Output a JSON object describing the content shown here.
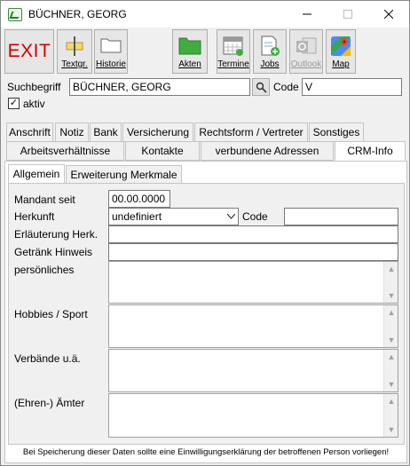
{
  "window": {
    "title": "BÜCHNER, GEORG"
  },
  "toolbar": {
    "exit_label": "EXIT",
    "buttons": [
      {
        "label": "Textgr."
      },
      {
        "label": "Historie"
      },
      {
        "label": "Akten"
      },
      {
        "label": "Termine"
      },
      {
        "label": "Jobs"
      },
      {
        "label": "Outlook"
      },
      {
        "label": "Map"
      }
    ]
  },
  "search": {
    "label": "Suchbegriff",
    "value": "BÜCHNER, GEORG",
    "code_label": "Code",
    "code_value": "V",
    "active_label": "aktiv",
    "active_checked": "✓"
  },
  "tabs_row1": [
    "Anschrift",
    "Notiz",
    "Bank",
    "Versicherung",
    "Rechtsform / Vertreter",
    "Sonstiges"
  ],
  "tabs_row2": [
    "Arbeitsverhältnisse",
    "Kontakte",
    "verbundene Adressen",
    "CRM-Info"
  ],
  "subtabs": [
    "Allgemein",
    "Erweiterung Merkmale"
  ],
  "form": {
    "mandant_label": "Mandant seit",
    "mandant_value": "00.00.0000",
    "herkunft_label": "Herkunft",
    "herkunft_value": "undefiniert",
    "code_label": "Code",
    "code_value": "",
    "erlaeuterung_label": "Erläuterung Herk.",
    "getraenk_label": "Getränk Hinweis",
    "persoenliches_label": "persönliches",
    "hobbies_label": "Hobbies / Sport",
    "verbaende_label": "Verbände u.ä.",
    "aemter_label": "(Ehren-) Ämter"
  },
  "footer": {
    "note": "Bei Speicherung dieser Daten sollte eine Einwilligungserklärung der betroffenen Person vorliegen!"
  }
}
